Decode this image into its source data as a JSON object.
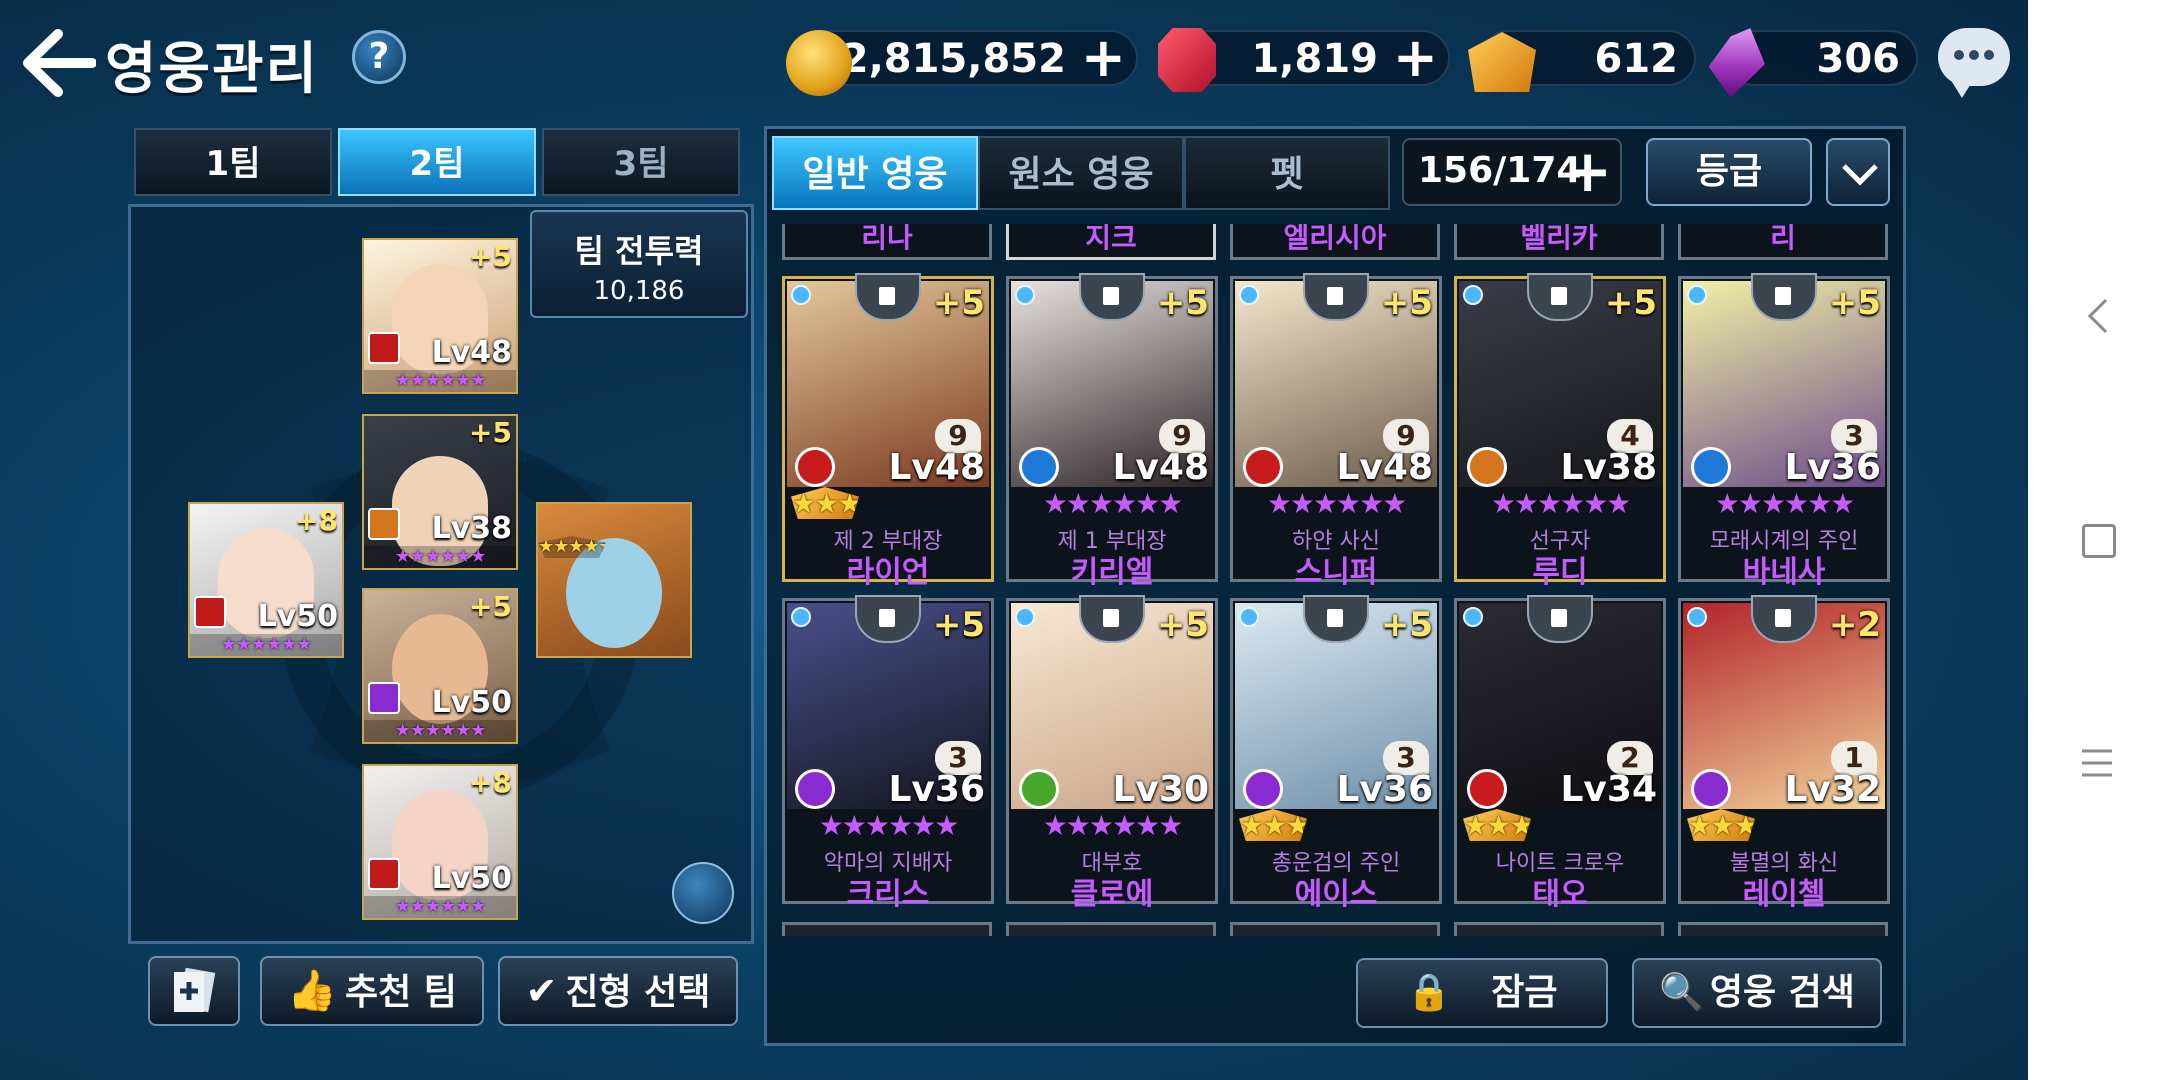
{
  "header": {
    "title": "영웅관리",
    "help": "?"
  },
  "currency": {
    "gold": "2,815,852",
    "ruby": "1,819",
    "gold_ore": "612",
    "crystal": "306"
  },
  "teams": {
    "tabs": [
      "1팀",
      "2팀",
      "3팀"
    ],
    "active": 1
  },
  "team_power": {
    "label": "팀 전투력",
    "value": "10,186"
  },
  "formation": [
    {
      "lv": "Lv48",
      "plus": "+5"
    },
    {
      "lv": "Lv38",
      "plus": "+5"
    },
    {
      "lv": "Lv50",
      "plus": "+8"
    },
    {
      "lv": "Lv50",
      "plus": "+5"
    },
    {
      "lv": "Lv50",
      "plus": "+8"
    }
  ],
  "left_buttons": {
    "recommend": "추천 팀",
    "formation_select": "진형 선택"
  },
  "hero_tabs": [
    "일반 영웅",
    "원소 영웅",
    "펫"
  ],
  "hero_count": "156/174",
  "sort": {
    "label": "등급"
  },
  "top_partial_names": [
    "리나",
    "지크",
    "엘리시아",
    "벨리카",
    "리"
  ],
  "heroes": [
    {
      "sub": "제 2 부대장",
      "name": "라이언",
      "lv": "Lv48",
      "plus": "+5",
      "badge": "9",
      "stars": "gold",
      "cls": "#c81b1b"
    },
    {
      "sub": "제 1 부대장",
      "name": "키리엘",
      "lv": "Lv48",
      "plus": "+5",
      "badge": "9",
      "stars": "purple",
      "cls": "#1e7ad8"
    },
    {
      "sub": "하얀 사신",
      "name": "스니퍼",
      "lv": "Lv48",
      "plus": "+5",
      "badge": "9",
      "stars": "purple",
      "cls": "#c81b1b"
    },
    {
      "sub": "선구자",
      "name": "루디",
      "lv": "Lv38",
      "plus": "+5",
      "badge": "4",
      "stars": "purple",
      "cls": "#d2751d"
    },
    {
      "sub": "모래시계의 주인",
      "name": "바네사",
      "lv": "Lv36",
      "plus": "+5",
      "badge": "3",
      "stars": "purple",
      "cls": "#1e7ad8"
    },
    {
      "sub": "악마의 지배자",
      "name": "크리스",
      "lv": "Lv36",
      "plus": "+5",
      "badge": "3",
      "stars": "purple",
      "cls": "#8a2bd0"
    },
    {
      "sub": "대부호",
      "name": "클로에",
      "lv": "Lv30",
      "plus": "+5",
      "badge": "",
      "stars": "purple",
      "cls": "#45a82a"
    },
    {
      "sub": "총운검의 주인",
      "name": "에이스",
      "lv": "Lv36",
      "plus": "+5",
      "badge": "3",
      "stars": "gold",
      "cls": "#8a2bd0"
    },
    {
      "sub": "나이트 크로우",
      "name": "태오",
      "lv": "Lv34",
      "plus": "",
      "badge": "2",
      "stars": "gold",
      "cls": "#c81b1b"
    },
    {
      "sub": "불멸의 화신",
      "name": "레이첼",
      "lv": "Lv32",
      "plus": "+2",
      "badge": "1",
      "stars": "gold",
      "cls": "#8a2bd0"
    }
  ],
  "bottom_buttons": {
    "lock": "잠금",
    "search": "영웅 검색"
  }
}
